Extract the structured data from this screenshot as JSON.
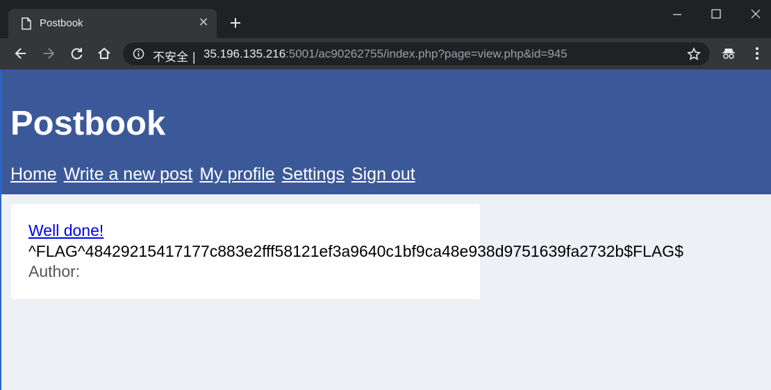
{
  "browser": {
    "tab": {
      "title": "Postbook",
      "icon": "document-icon",
      "close_icon": "close-icon"
    },
    "new_tab_icon": "plus-icon",
    "window_controls": [
      "minimize-icon",
      "maximize-icon",
      "close-icon"
    ],
    "toolbar": {
      "icons": [
        "back-arrow-icon",
        "forward-arrow-icon",
        "reload-icon",
        "home-icon"
      ],
      "security_label": "不安全",
      "separator": "|",
      "url_host": "35.196.135.216",
      "url_rest": ":5001/ac90262755/index.php?page=view.php&id=945",
      "bookmark_icon": "star-icon",
      "extension_icon": "incognito-icon",
      "menu_icon": "kebab-menu-icon"
    },
    "colors": {
      "tabstrip": "#202124",
      "toolbar": "#35363a",
      "omnibox": "#202124"
    }
  },
  "site": {
    "title": "Postbook",
    "nav": [
      "Home",
      "Write a new post",
      "My profile",
      "Settings",
      "Sign out"
    ],
    "colors": {
      "header_bg": "#3b5998",
      "page_bg": "#edf0f5",
      "link": "#0000ee"
    }
  },
  "post": {
    "title": "Well done!",
    "body": "^FLAG^48429215417177c883e2fff58121ef3a9640c1bf9ca48e938d9751639fa2732b$FLAG$",
    "author_label": "Author:"
  }
}
